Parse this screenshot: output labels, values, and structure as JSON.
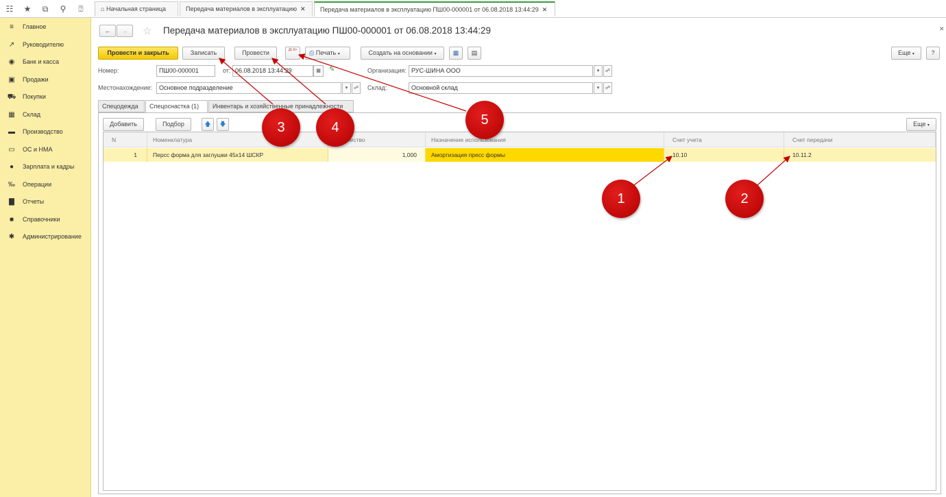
{
  "tabs": {
    "home": "Начальная страница",
    "list": "Передача материалов в эксплуатацию",
    "doc": "Передача материалов в эксплуатацию ПШ00-000001 от 06.08.2018 13:44:29"
  },
  "sidebar": {
    "items": [
      {
        "label": "Главное",
        "icon": "menu-icon"
      },
      {
        "label": "Руководителю",
        "icon": "trend-icon"
      },
      {
        "label": "Банк и касса",
        "icon": "bank-icon"
      },
      {
        "label": "Продажи",
        "icon": "bag-icon"
      },
      {
        "label": "Покупки",
        "icon": "cart-icon"
      },
      {
        "label": "Склад",
        "icon": "warehouse-icon"
      },
      {
        "label": "Производство",
        "icon": "factory-icon"
      },
      {
        "label": "ОС и НМА",
        "icon": "truck-icon"
      },
      {
        "label": "Зарплата и кадры",
        "icon": "person-icon"
      },
      {
        "label": "Операции",
        "icon": "operations-icon"
      },
      {
        "label": "Отчеты",
        "icon": "chart-icon"
      },
      {
        "label": "Справочники",
        "icon": "book-icon"
      },
      {
        "label": "Администрирование",
        "icon": "gear-icon"
      }
    ]
  },
  "header": {
    "title": "Передача материалов в эксплуатацию ПШ00-000001 от 06.08.2018 13:44:29"
  },
  "toolbar": {
    "post_close": "Провести и закрыть",
    "save": "Записать",
    "post": "Провести",
    "dt_kt": "Дт Кт",
    "print": "Печать",
    "create_based": "Создать на основании",
    "more": "Еще",
    "help": "?"
  },
  "form": {
    "number_label": "Номер:",
    "number_value": "ПШ00-000001",
    "date_label": "от:",
    "date_value": "06.08.2018 13:44:29",
    "org_label": "Организация:",
    "org_value": "РУС-ШИНА ООО",
    "location_label": "Местонахождение:",
    "location_value": "Основное подразделение",
    "warehouse_label": "Склад:",
    "warehouse_value": "Основной склад"
  },
  "form_tabs": [
    "Спецодежда",
    "Спецоснастка (1)",
    "Инвентарь и хозяйственные принадлежности"
  ],
  "table_toolbar": {
    "add": "Добавить",
    "pick": "Подбор",
    "more": "Еще"
  },
  "table": {
    "columns": [
      "N",
      "Номенклатура",
      "Количество",
      "Назначение использования",
      "Счет учета",
      "Счет передачи"
    ],
    "rows": [
      [
        "1",
        "Персс форма для заглушки 45х14 ШСКР",
        "1,000",
        "Амортизация пресс формы",
        "10.10",
        "10.11.2"
      ]
    ]
  },
  "annotations": [
    "1",
    "2",
    "3",
    "4",
    "5"
  ],
  "colors": {
    "sidebar": "#fbeea6",
    "primary_button": "#f5c900",
    "selected_row": "#fcf3b5",
    "marker": "#c40000"
  }
}
